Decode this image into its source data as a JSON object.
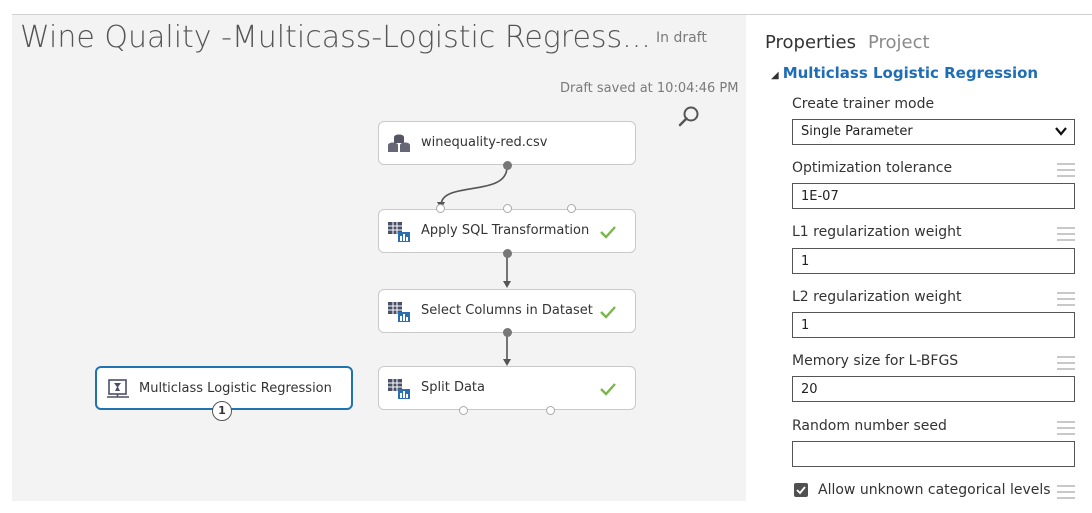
{
  "experiment": {
    "title": "Wine Quality -Multicass-Logistic Regress...",
    "status": "In draft",
    "saved_text": "Draft saved at 10:04:46 PM"
  },
  "modules": {
    "dataset": {
      "label": "winequality-red.csv",
      "icon": "dataset-icon"
    },
    "sql": {
      "label": "Apply SQL Transformation",
      "icon": "transform-icon"
    },
    "select": {
      "label": "Select Columns in Dataset",
      "icon": "transform-icon"
    },
    "split": {
      "label": "Split Data",
      "icon": "transform-icon"
    },
    "mlr": {
      "label": "Multiclass Logistic Regression",
      "icon": "model-icon",
      "badge": "1"
    }
  },
  "panel": {
    "tabs": {
      "properties": "Properties",
      "project": "Project"
    },
    "section": "Multiclass Logistic Regression",
    "fields": {
      "trainer_mode": {
        "label": "Create trainer mode",
        "value": "Single Parameter"
      },
      "opt_tol": {
        "label": "Optimization tolerance",
        "value": "1E-07"
      },
      "l1": {
        "label": "L1 regularization weight",
        "value": "1"
      },
      "l2": {
        "label": "L2 regularization weight",
        "value": "1"
      },
      "memory": {
        "label": "Memory size for L-BFGS",
        "value": "20"
      },
      "seed": {
        "label": "Random number seed",
        "value": ""
      },
      "allow_unknown": {
        "label": "Allow unknown categorical levels",
        "checked": true
      }
    }
  },
  "colors": {
    "accent": "#1f6db4",
    "selected_border": "#1e73b0",
    "check": "#7ab648",
    "canvas": "#f3f3f3"
  }
}
